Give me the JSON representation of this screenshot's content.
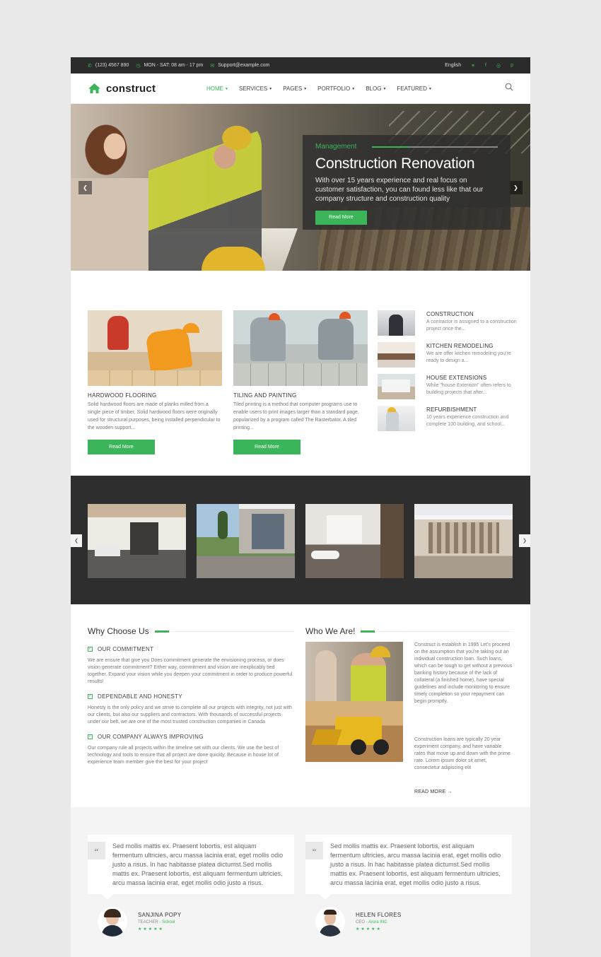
{
  "topbar": {
    "phone": "(123) 4567 890",
    "hours": "MON - SAT: 08 am - 17 pm",
    "email": "Support@example.com",
    "language": "English",
    "social": [
      "twitter-icon",
      "facebook-icon",
      "instagram-icon",
      "pinterest-icon"
    ]
  },
  "nav": {
    "logo": "construct",
    "menu": [
      {
        "label": "HOME"
      },
      {
        "label": "SERVICES"
      },
      {
        "label": "PAGES"
      },
      {
        "label": "PORTFOLIO"
      },
      {
        "label": "BLOG"
      },
      {
        "label": "FEATURED"
      }
    ]
  },
  "hero": {
    "tag": "Management",
    "title": "Construction Renovation",
    "text": "With over 15 years experience and real focus on customer satisfaction, you can found less like that our company structure and construction quality",
    "button": "Read More"
  },
  "services": {
    "cards": [
      {
        "title": "HARDWOOD FLOORING",
        "text": "Solid hardwood floors are made of planks milled from a single piece of timber. Solid hardwood floors were originally used for structural purposes, being installed perpendicular to the wooden support...",
        "button": "Read More"
      },
      {
        "title": "TILING AND PAINTING",
        "text": "Tiled printing is a method that computer programs use to enable users to print images larger than a standard page, popularized by a program called The Rasterbator. A tiled printing...",
        "button": "Read More"
      }
    ],
    "list": [
      {
        "title": "CONSTRUCTION",
        "text": "A contractor is assigned to a construction project once the..."
      },
      {
        "title": "KITCHEN REMODELING",
        "text": "We are offer kitchen remodeling you're ready to design a..."
      },
      {
        "title": "HOUSE EXTENSIONS",
        "text": "While \"house Extention\" often refers to building projects that after..."
      },
      {
        "title": "REFURBISHMENT",
        "text": "10 years experience construction and complete 100 building, and school..."
      }
    ]
  },
  "why": {
    "title": "Why Choose Us",
    "items": [
      {
        "head": "OUR COMMITMENT",
        "text": "We are ensure that give you Does commitment generate the envisioning process, or does vision generate commitment? Either way, commitment and vision are inexplicably tied together. Expand your vision while you deepen your commitment in order to produce powerful results!"
      },
      {
        "head": "DEPENDABLE AND HONESTY",
        "text": "Honesty is the only policy and we strive to complete all our projects with integrity, not just with our clients, but also our suppliers and contractors. With thousands of successful projects under our belt, we are one of the most trusted construction companies in Canada"
      },
      {
        "head": "OUR COMPANY ALWAYS IMPROVING",
        "text": "Our company rule all projects within the timeline set with our clients. We use the best of technology and tools to ensure that all project are done quickly. Because in house lot of experience team member give the best for your project"
      }
    ]
  },
  "who": {
    "title": "Who We Are!",
    "text1": "Construct is establish in 1995 Let's proceed on the assumption that you're taking out an individual construction loan. Such loans, which can be tough to get without a previous banking history because of the lack of collateral (a finished home), have special guidelines and include monitoring to ensure timely completion so your repayment can begin promptly.",
    "text2": "Construction loans are typically 20 year experiment company, and have variable rates that move up and down with the prime rate. Lorem ipsum dolor sit amet, consectetur adipiscing elit",
    "read_more": "READ MORE →"
  },
  "testimonials": [
    {
      "quote": "Sed mollis mattis ex. Praesent lobortis, est aliquam fermentum ultricies, arcu massa lacinia erat, eget mollis odio justo a risus. In hac habitasse platea dictumst.Sed mollis mattis ex. Praesent lobortis, est aliquam fermentum ultricies, arcu massa lacinia erat, eget mollis odio justo a risus.",
      "name": "SANJINA POPY",
      "role": "TEACHER",
      "org": "School",
      "stars": "★★★★★",
      "rating": 5
    },
    {
      "quote": "Sed mollis mattis ex. Praesent lobortis, est aliquam fermentum ultricies, arcu massa lacinia erat, eget mollis odio justo a risus. In hac habitasse platea dictumst.Sed mollis mattis ex. Praesent lobortis, est aliquam fermentum ultricies, arcu massa lacinia erat, eget mollis odio justo a risus.",
      "name": "HELEN FLORES",
      "role": "CEO",
      "org": "Arora INC",
      "stars": "★★★★★",
      "rating": 5
    }
  ],
  "colors": {
    "accent": "#3cb55a",
    "dark": "#2e2e2e",
    "topbar": "#2b2b2b"
  }
}
